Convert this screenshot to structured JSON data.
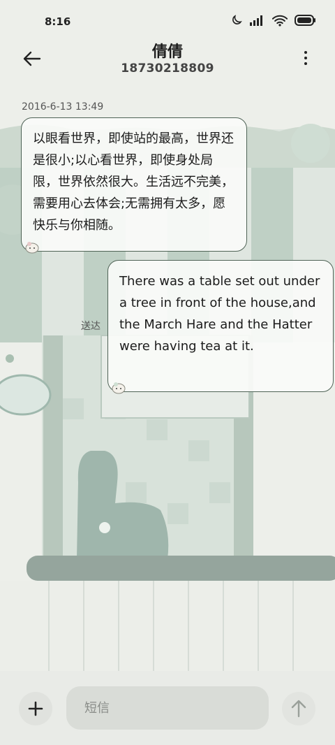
{
  "status": {
    "time": "8:16"
  },
  "header": {
    "contact_name": "倩倩",
    "phone_number": "18730218809"
  },
  "conversation": {
    "timestamp": "2016-6-13 13:49",
    "messages": [
      {
        "direction": "incoming",
        "text": "以眼看世界，即使站的最高，世界还是很小;以心看世界，即使身处局限，世界依然很大。生活远不完美，需要用心去体会;无需拥有太多，愿快乐与你相随。"
      },
      {
        "direction": "outgoing",
        "text": "There was a table set out under a tree in front of the house,and the March Hare and the Hatter were having tea at it.",
        "status": "送达"
      }
    ]
  },
  "composer": {
    "placeholder": "短信"
  },
  "icons": {
    "back": "arrow-left-icon",
    "more": "more-vertical-icon",
    "add": "plus-icon",
    "send": "arrow-up-icon",
    "moon": "moon-icon",
    "signal": "signal-icon",
    "wifi": "wifi-icon",
    "battery": "battery-icon"
  },
  "colors": {
    "bubble_border": "#4f6356",
    "background": "#eceee9",
    "wallpaper_accent": "#a9bfb1"
  }
}
